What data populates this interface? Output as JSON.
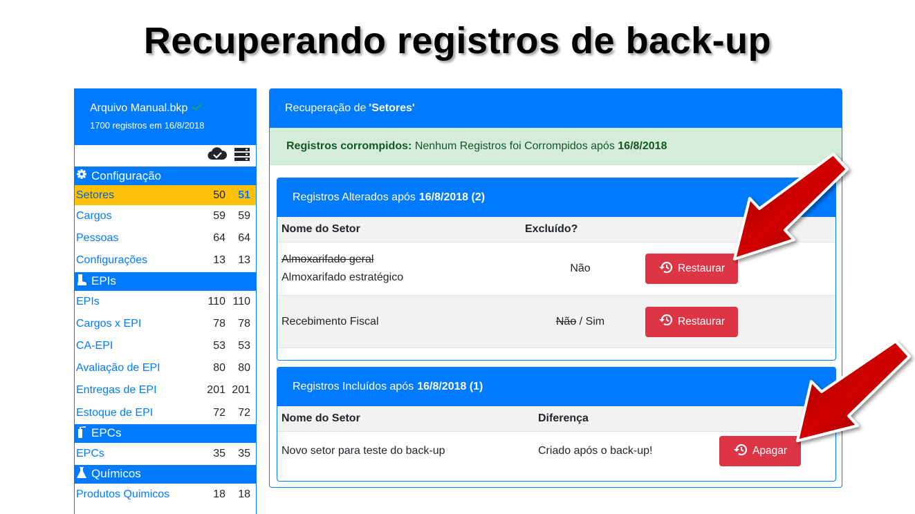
{
  "slide_title": "Recuperando registros de back-up",
  "sidebar": {
    "file_name": "Arquivo Manual.bkp",
    "file_sub": "1700 registros em 16/8/2018",
    "icons": [
      "cloud-check-icon",
      "database-icon"
    ],
    "sections": [
      {
        "title": "Configuração",
        "icon": "gear-icon",
        "items": [
          {
            "label": "Setores",
            "a": "50",
            "b": "51"
          },
          {
            "label": "Cargos",
            "a": "59",
            "b": "59"
          },
          {
            "label": "Pessoas",
            "a": "64",
            "b": "64"
          },
          {
            "label": "Configurações",
            "a": "13",
            "b": "13"
          }
        ]
      },
      {
        "title": "EPIs",
        "icon": "boot-icon",
        "items": [
          {
            "label": "EPIs",
            "a": "110",
            "b": "110"
          },
          {
            "label": "Cargos x EPI",
            "a": "78",
            "b": "78"
          },
          {
            "label": "CA-EPI",
            "a": "53",
            "b": "53"
          },
          {
            "label": "Avaliação de EPI",
            "a": "80",
            "b": "80"
          },
          {
            "label": "Entregas de EPI",
            "a": "201",
            "b": "201"
          },
          {
            "label": "Estoque de EPI",
            "a": "72",
            "b": "72"
          }
        ]
      },
      {
        "title": "EPCs",
        "icon": "extinguisher-icon",
        "items": [
          {
            "label": "EPCs",
            "a": "35",
            "b": "35"
          }
        ]
      },
      {
        "title": "Químicos",
        "icon": "flask-icon",
        "items": [
          {
            "label": "Produtos Quimicos",
            "a": "18",
            "b": "18"
          }
        ]
      }
    ]
  },
  "main": {
    "header_prefix": "Recuperação de",
    "header_entity": "'Setores'",
    "alert_label": "Registros corrompidos:",
    "alert_text": "Nenhum Registros foi Corrompidos após",
    "alert_date": "16/8/2018",
    "altered": {
      "title_prefix": "Registros Alterados após",
      "title_bold": "16/8/2018 (2)",
      "col1": "Nome do Setor",
      "col2": "Excluído?",
      "rows": [
        {
          "old_name": "Almoxarifado geral",
          "new_name": "Almoxarifado estratégico",
          "deleted": "Não",
          "button": "Restaurar"
        },
        {
          "name": "Recebimento Fiscal",
          "old_deleted": "Não",
          "sep": "/",
          "new_deleted": "Sim",
          "button": "Restaurar"
        }
      ]
    },
    "included": {
      "title_prefix": "Registros Incluídos após",
      "title_bold": "16/8/2018 (1)",
      "col1": "Nome do Setor",
      "col2": "Diferença",
      "rows": [
        {
          "name": "Novo setor para teste do back-up",
          "diff": "Criado após o back-up!",
          "button": "Apagar"
        }
      ]
    }
  },
  "colors": {
    "primary": "#007bff",
    "danger": "#dc3545",
    "warning": "#ffc107",
    "success_bg": "#d4edda",
    "success_text": "#155724",
    "arrow": "#b00000"
  }
}
